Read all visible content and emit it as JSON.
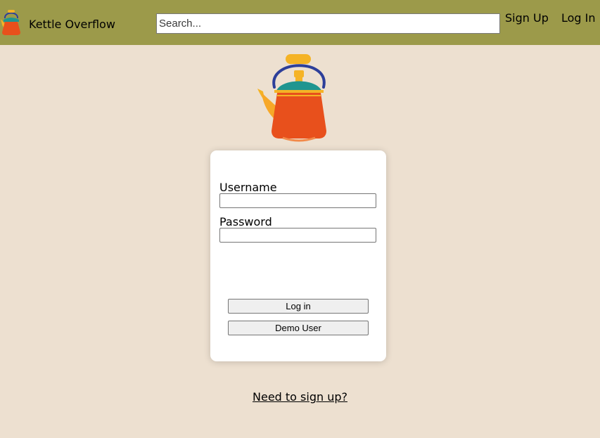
{
  "navbar": {
    "logo_icon": "kettle-icon",
    "title": "Kettle Overflow",
    "search_placeholder": "Search...",
    "sign_up_label": "Sign Up",
    "log_in_label": "Log In"
  },
  "hero": {
    "icon": "kettle-illustration-icon"
  },
  "login_form": {
    "username_label": "Username",
    "username_value": "",
    "password_label": "Password",
    "password_value": "",
    "login_button": "Log in",
    "demo_button": "Demo User"
  },
  "signup_prompt": "Need to sign up?",
  "colors": {
    "navbar": "#9c9a4a",
    "background": "#ede0d0",
    "card": "#ffffff",
    "kettle_body": "#e8501c",
    "kettle_lid": "#1f9590",
    "kettle_handle": "#2d3f9a",
    "kettle_spout": "#f5b325"
  }
}
